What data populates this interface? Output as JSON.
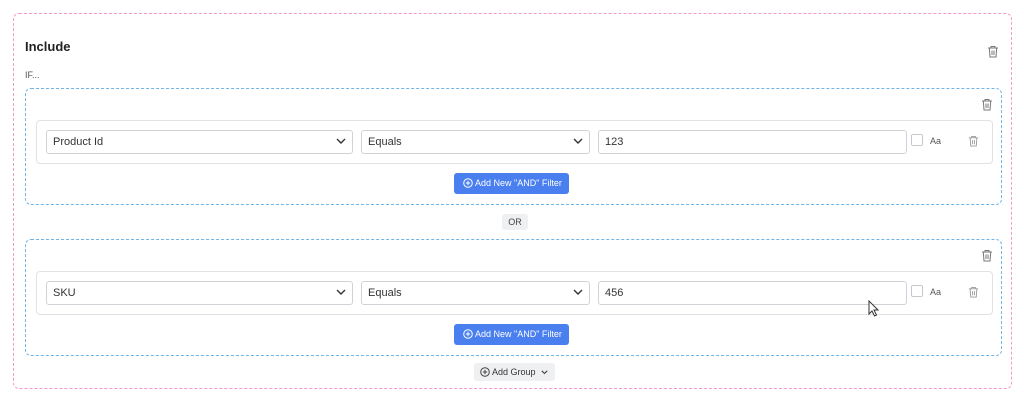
{
  "include": {
    "title": "Include",
    "if_label": "IF...",
    "or_label": "OR",
    "add_group_label": "Add Group",
    "groups": [
      {
        "filter": {
          "field": "Product Id",
          "operator": "Equals",
          "value": "123",
          "case_label": "Aa"
        },
        "add_filter_label": "Add New \"AND\" Filter"
      },
      {
        "filter": {
          "field": "SKU",
          "operator": "Equals",
          "value": "456",
          "case_label": "Aa"
        },
        "add_filter_label": "Add New \"AND\" Filter"
      }
    ]
  },
  "colors": {
    "include_border": "#f49ac9",
    "group_border": "#6fb4e8",
    "primary_button": "#4a7ff0"
  },
  "icons": {
    "trash": "trash-icon",
    "chevron": "chevron-down-icon",
    "plus": "plus-circle-icon",
    "cursor": "mouse-cursor-icon"
  }
}
